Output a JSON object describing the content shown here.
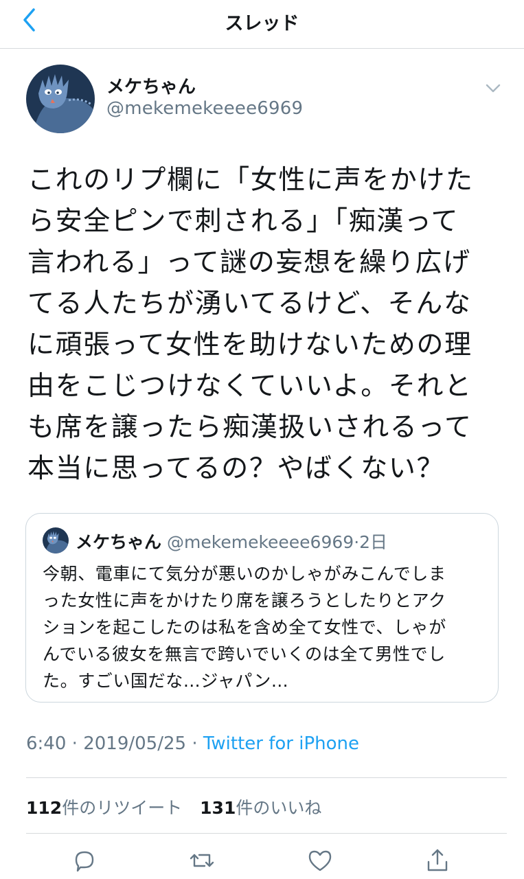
{
  "nav": {
    "title": "スレッド"
  },
  "tweet": {
    "display_name": "メケちゃん",
    "handle": "@mekemekeeee6969",
    "text": "これのリプ欄に「女性に声をかけた\nら安全ピンで刺される」「痴漢って\n言われる」って謎の妄想を繰り広げ\nてる人たちが湧いてるけど、そんな\nに頑張って女性を助けないための理\n由をこじつけなくていいよ。それと\nも席を譲ったら痴漢扱いされるって\n本当に思ってるの？やばくない？",
    "time": "6:40",
    "date": "2019/05/25",
    "source": "Twitter for iPhone"
  },
  "quote": {
    "display_name": "メケちゃん",
    "handle": "@mekemekeeee6969",
    "age": "2日",
    "text": "今朝、電車にて気分が悪いのかしゃがみこんでしま\nった女性に声をかけたり席を譲ろうとしたりとアク\nションを起こしたのは私を含め全て女性で、しゃが\nんでいる彼女を無言で跨いでいくのは全て男性でし\nた。すごい国だな…ジャパン…"
  },
  "stats": {
    "retweets_count": "112",
    "retweets_label": "件のリツイート",
    "likes_count": "131",
    "likes_label": "件のいいね"
  },
  "icons": {
    "back": "chevron-left-icon",
    "more": "chevron-down-icon",
    "reply": "speech-bubble-icon",
    "retweet": "retweet-arrows-icon",
    "like": "heart-icon",
    "share": "share-upload-icon"
  },
  "colors": {
    "accent": "#1da1f2",
    "secondary_text": "#657786",
    "avatar_bg": "#1f3653"
  }
}
